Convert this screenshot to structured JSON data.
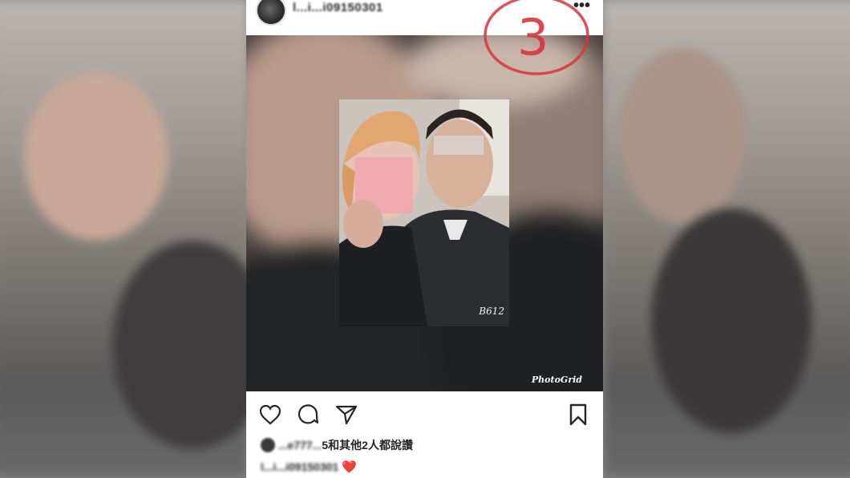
{
  "post": {
    "username": "l...i...i09150301",
    "photo": {
      "inner_watermark": "B612",
      "outer_watermark": "PhotoGrid",
      "annotation_number": "3"
    },
    "actions": {
      "like_icon": "heart-outline-icon",
      "comment_icon": "comment-bubble-icon",
      "share_icon": "paper-plane-icon",
      "save_icon": "bookmark-icon",
      "more_icon": "more-dots-icon",
      "more_label": "•••"
    },
    "likes": {
      "liker_name": "...e777...",
      "text": "5和其他2人都說讚"
    },
    "caption": {
      "username": "l...i...i09150301",
      "emoji": "❤️"
    }
  },
  "colors": {
    "text": "#262626",
    "heart": "#e0233b",
    "annotation_red": "#d9343b"
  }
}
